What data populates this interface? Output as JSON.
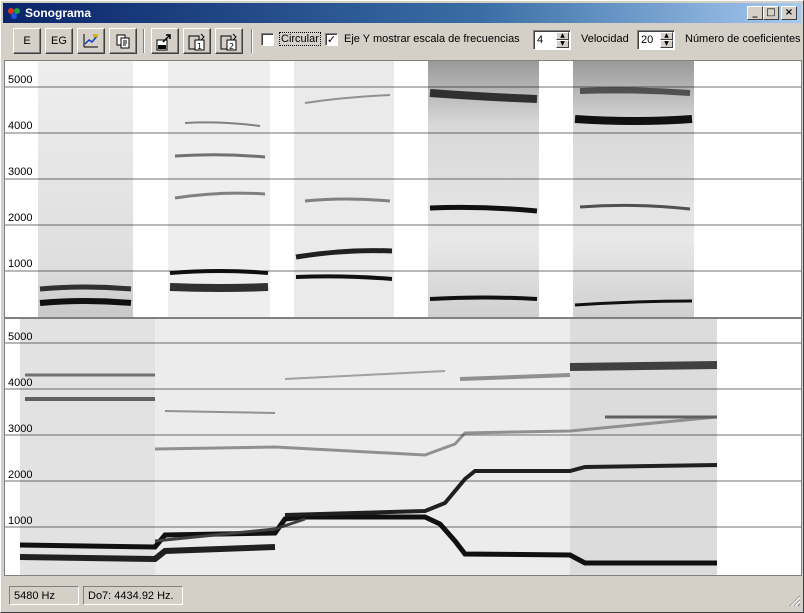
{
  "window": {
    "title": "Sonograma",
    "buttons": {
      "minimize": "_",
      "maximize": "□",
      "close": "×"
    }
  },
  "toolbar": {
    "btn_e": "E",
    "btn_eg": "EG",
    "icons": [
      "chart-edit-icon",
      "copy-icon",
      "export-icon",
      "paste-1-icon",
      "paste-2-icon"
    ],
    "circular": {
      "label": "Circular",
      "checked": false
    },
    "eje_y": {
      "label": "Eje Y mostrar escala de frecuencias",
      "checked": true
    },
    "scale_value": "4",
    "velocidad": {
      "label": "Velocidad",
      "value": "20"
    },
    "coef_label": "Número de coeficientes"
  },
  "plots": {
    "top": {
      "ticks": [
        "5000",
        "4000",
        "3000",
        "2000",
        "1000"
      ]
    },
    "bottom": {
      "ticks": [
        "5000",
        "4000",
        "3000",
        "2000",
        "1000"
      ]
    }
  },
  "status": {
    "freq": "5480  Hz",
    "note": "Do7: 4434.92 Hz."
  },
  "colors": {
    "face": "#d4d0c8",
    "title_start": "#0a246a",
    "title_end": "#a6caf0",
    "ink": "#000000"
  }
}
